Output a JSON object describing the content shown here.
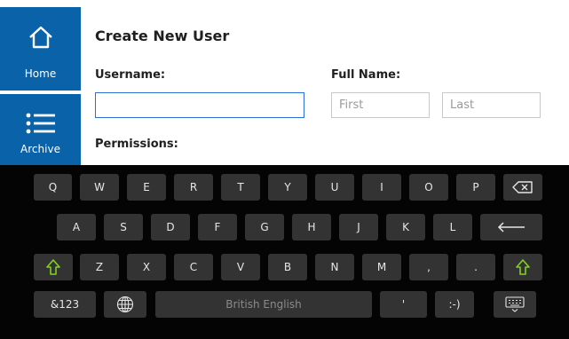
{
  "sidebar": {
    "items": [
      {
        "label": "Home",
        "icon": "home-icon"
      },
      {
        "label": "Archive",
        "icon": "list-icon"
      }
    ],
    "active_color": "#0a62a8"
  },
  "form": {
    "title": "Create New User",
    "username_label": "Username:",
    "username_value": "",
    "fullname_label": "Full Name:",
    "first_placeholder": "First",
    "last_placeholder": "Last",
    "permissions_label": "Permissions:"
  },
  "keyboard": {
    "row1": [
      "Q",
      "W",
      "E",
      "R",
      "T",
      "Y",
      "U",
      "I",
      "O",
      "P"
    ],
    "row2": [
      "A",
      "S",
      "D",
      "F",
      "G",
      "H",
      "J",
      "K",
      "L"
    ],
    "row3": [
      "Z",
      "X",
      "C",
      "V",
      "B",
      "N",
      "M",
      ",",
      "."
    ],
    "symbols_label": "&123",
    "space_label": "British English",
    "apostrophe_label": "'",
    "smiley_label": ":-)",
    "icons": [
      "backspace-icon",
      "enter-icon",
      "shift-icon",
      "globe-icon",
      "keyboard-hide-icon"
    ],
    "shift_color": "#7ed321"
  }
}
